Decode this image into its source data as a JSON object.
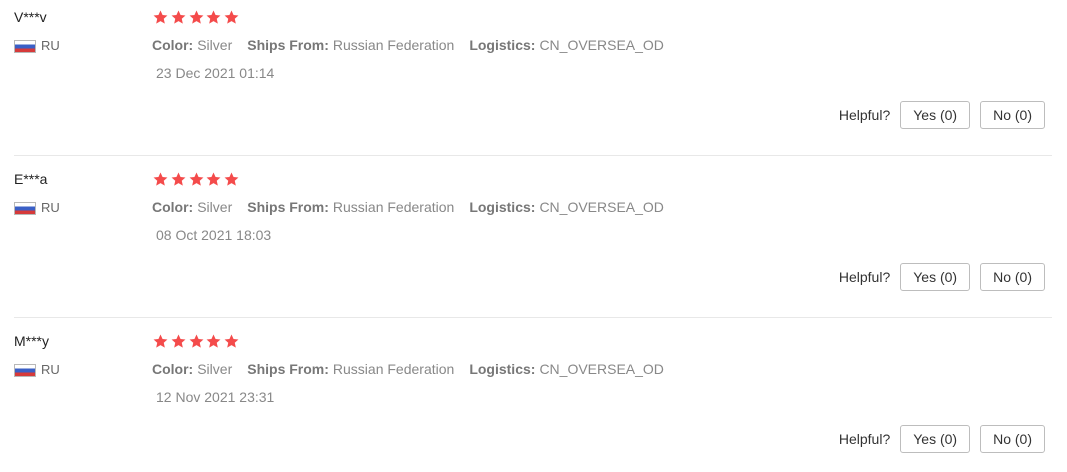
{
  "colors": {
    "star": "#f44b4b",
    "divider": "#e8e8e8",
    "label": "#777777",
    "value": "#888888"
  },
  "icons": {
    "flag": "russia-flag-icon",
    "star": "star-icon"
  },
  "labels": {
    "color": "Color:",
    "ships_from": "Ships From:",
    "logistics": "Logistics:",
    "helpful": "Helpful?"
  },
  "reviews": [
    {
      "user": "V***v",
      "country": "RU",
      "rating": 5,
      "color": "Silver",
      "ships_from": "Russian Federation",
      "logistics": "CN_OVERSEA_OD",
      "date": "23 Dec 2021 01:14",
      "yes_label": "Yes (0)",
      "no_label": "No (0)"
    },
    {
      "user": "E***a",
      "country": "RU",
      "rating": 5,
      "color": "Silver",
      "ships_from": "Russian Federation",
      "logistics": "CN_OVERSEA_OD",
      "date": "08 Oct 2021 18:03",
      "yes_label": "Yes (0)",
      "no_label": "No (0)"
    },
    {
      "user": "M***y",
      "country": "RU",
      "rating": 5,
      "color": "Silver",
      "ships_from": "Russian Federation",
      "logistics": "CN_OVERSEA_OD",
      "date": "12 Nov 2021 23:31",
      "yes_label": "Yes (0)",
      "no_label": "No (0)"
    }
  ]
}
